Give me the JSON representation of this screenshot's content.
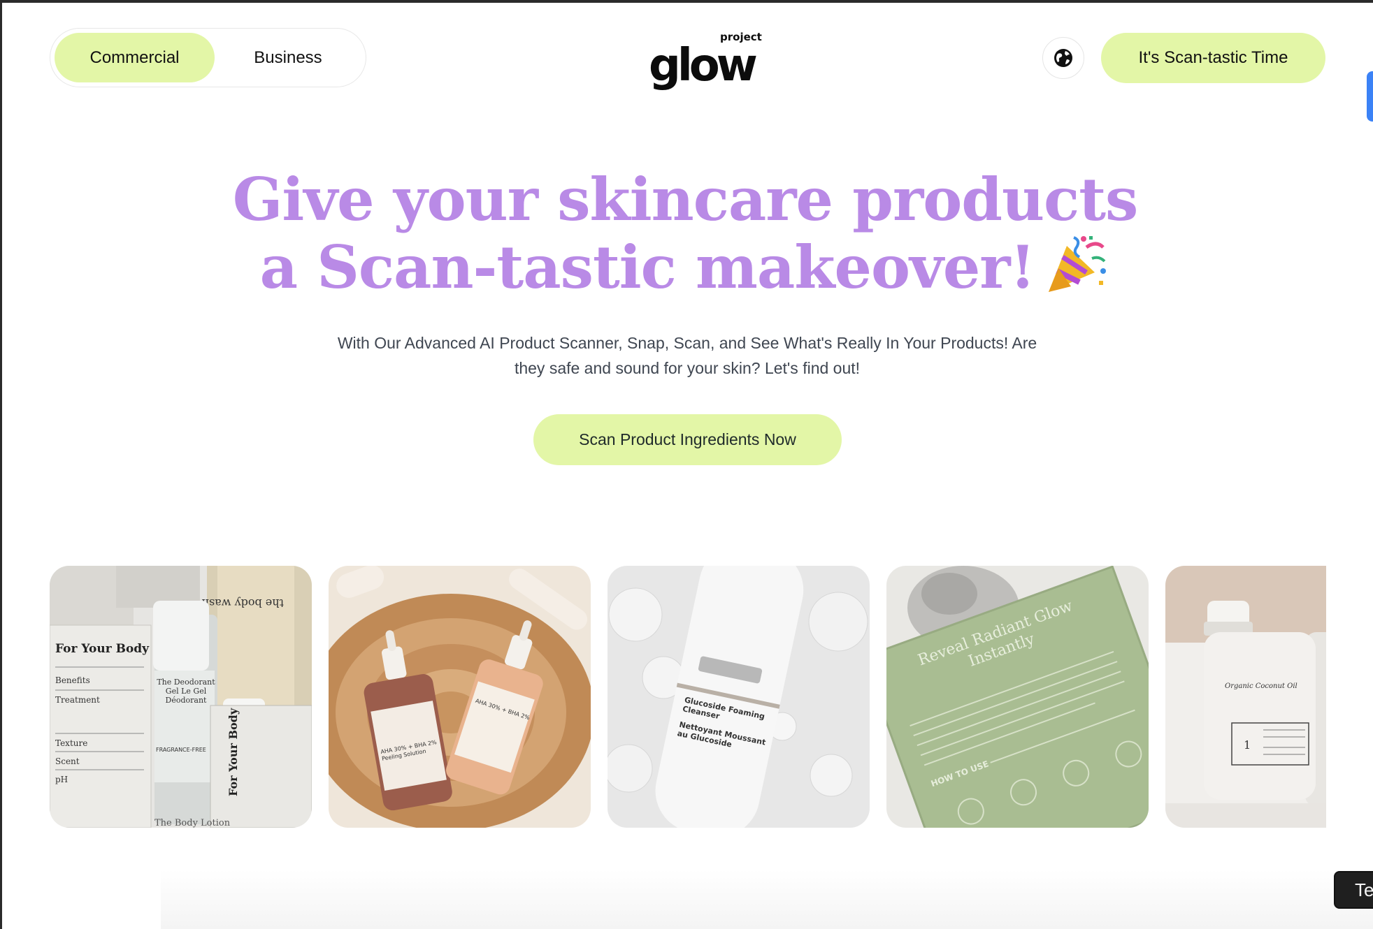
{
  "header": {
    "toggle": {
      "commercial_label": "Commercial",
      "business_label": "Business"
    },
    "logo": {
      "main": "glow",
      "sub": "project"
    },
    "cta_label": "It's Scan-tastic Time"
  },
  "hero": {
    "title_line1": "Give your skincare products",
    "title_line2": "a Scan-tastic makeover!",
    "subtitle": "With Our Advanced AI Product Scanner, Snap, Scan, and See What's Really In Your Products! Are they safe and sound for your skin? Let's find out!",
    "cta_label": "Scan Product Ingredients Now"
  },
  "cards": [
    {
      "name": "body-products-card",
      "text_title": "For Your Body",
      "labels": [
        "Benefits",
        "Treatment",
        "Texture",
        "Scent",
        "pH"
      ],
      "bottom_text": "The Body Lotion",
      "tube_text": "The Deodorant Gel Le Gel Déodorant",
      "box_text": "For Your Body",
      "product_tag": "FRAGRANCE-FREE"
    },
    {
      "name": "serum-bottles-card",
      "label_a": "AHA 30% + BHA 2% Peeling Solution",
      "label_b": "AHA 30% + BHA 2%"
    },
    {
      "name": "cleanser-tube-card",
      "label": "Glucoside Foaming Cleanser",
      "label_fr": "Nettoyant Moussant au Glucoside"
    },
    {
      "name": "green-box-card",
      "headline": "Reveal Radiant Glow Instantly",
      "howto": "HOW TO USE"
    },
    {
      "name": "coconut-oil-card",
      "label": "Organic Coconut Oil",
      "number": "1"
    }
  ],
  "chat_chip": {
    "label": "Te"
  },
  "colors": {
    "accent": "#e3f6a7",
    "headline": "#b98ae6",
    "text": "#3f4651"
  },
  "icons": {
    "globe": "globe-icon",
    "party": "party-popper-icon"
  }
}
